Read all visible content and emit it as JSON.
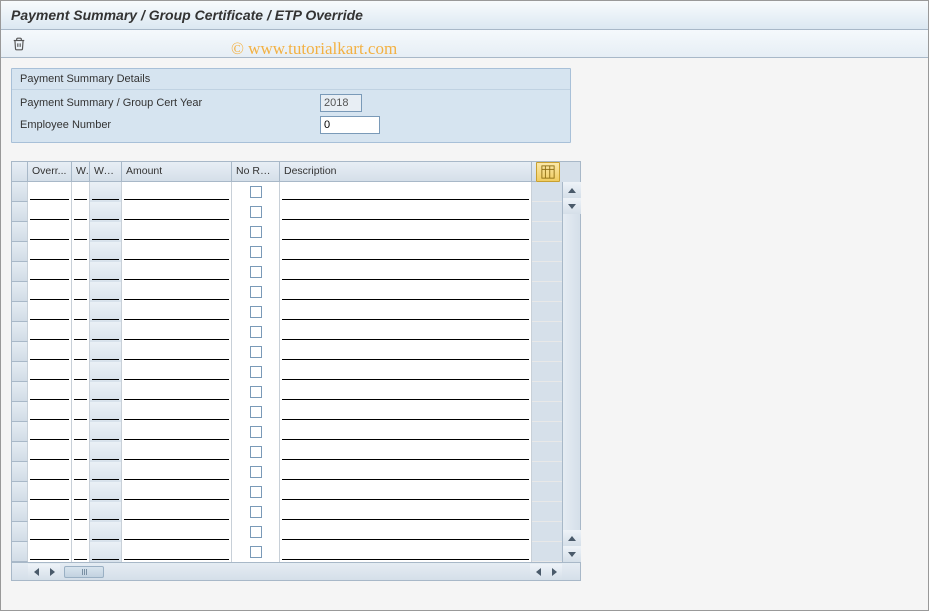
{
  "title": "Payment Summary / Group Certificate / ETP Override",
  "watermark": "© www.tutorialkart.com",
  "toolbar": {
    "delete_icon": "trash-icon"
  },
  "group": {
    "title": "Payment Summary Details",
    "fields": {
      "year_label": "Payment Summary / Group Cert Year",
      "year_value": "2018",
      "emp_label": "Employee Number",
      "emp_value": "0"
    }
  },
  "grid": {
    "columns": {
      "overr": "Overr...",
      "w": "W.",
      "wa": "Wa...",
      "amount": "Amount",
      "norev": "No Rev...",
      "desc": "Description"
    },
    "row_count": 19
  }
}
